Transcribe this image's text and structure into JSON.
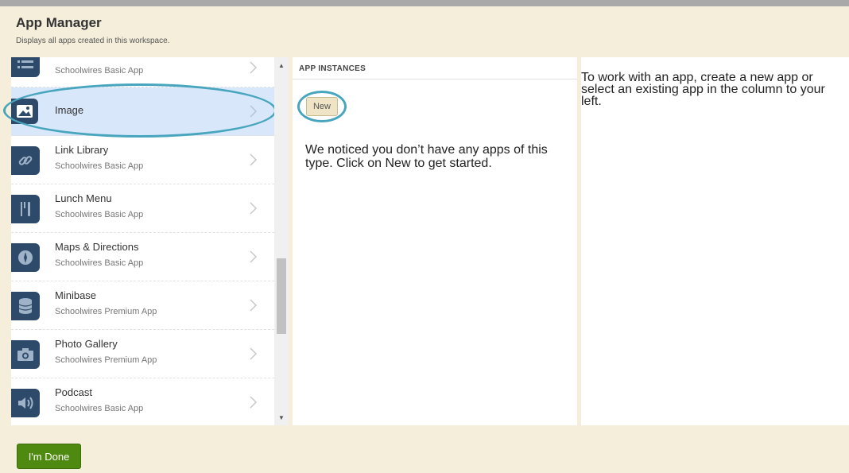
{
  "header": {
    "title": "App Manager",
    "subtitle": "Displays all apps created in this workspace."
  },
  "app_list": [
    {
      "name": "",
      "desc": "Schoolwires Basic App",
      "icon": "list-icon"
    },
    {
      "name": "Image",
      "desc": "",
      "icon": "image-icon",
      "selected": true
    },
    {
      "name": "Link Library",
      "desc": "Schoolwires Basic App",
      "icon": "link-icon"
    },
    {
      "name": "Lunch Menu",
      "desc": "Schoolwires Basic App",
      "icon": "utensils-icon"
    },
    {
      "name": "Maps & Directions",
      "desc": "Schoolwires Basic App",
      "icon": "compass-icon"
    },
    {
      "name": "Minibase",
      "desc": "Schoolwires Premium App",
      "icon": "database-icon"
    },
    {
      "name": "Photo Gallery",
      "desc": "Schoolwires Premium App",
      "icon": "camera-icon"
    },
    {
      "name": "Podcast",
      "desc": "Schoolwires Basic App",
      "icon": "speaker-icon"
    }
  ],
  "instances": {
    "header": "APP INSTANCES",
    "new_label": "New",
    "message": "We noticed you don’t have any apps of this type. Click on New to get started."
  },
  "info": {
    "message": "To work with an app, create a new app or select an existing app in the column to your left."
  },
  "footer": {
    "done_label": "I'm Done"
  },
  "colors": {
    "background": "#f4eedb",
    "icon_tile": "#2e4a6b",
    "selected_row": "#d9e7fb",
    "highlight_ring": "#47a5bd",
    "done_button": "#4f8a10"
  }
}
